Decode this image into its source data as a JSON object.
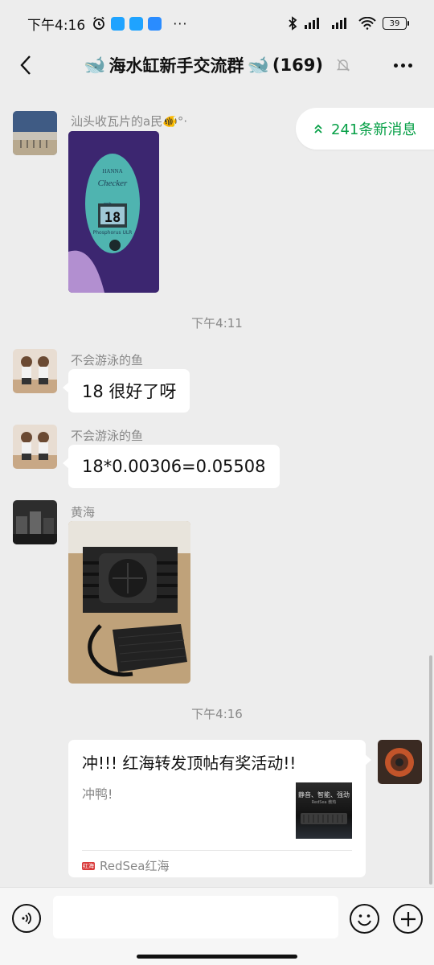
{
  "status_bar": {
    "time": "下午4:16",
    "more": "···",
    "battery": "39"
  },
  "header": {
    "whale_left": "🐋",
    "title": "海水缸新手交流群",
    "whale_right": "🐋",
    "member_count": "(169)"
  },
  "new_messages": {
    "label": "241条新消息"
  },
  "messages": [
    {
      "sender": "汕头收瓦片的a民🐠°·",
      "type": "image",
      "image_text": {
        "brand": "HANNA",
        "model": "Checker",
        "reading": "18",
        "unit": "ppb",
        "product": "Phosphorus ULR"
      }
    },
    {
      "type": "time",
      "text": "下午4:11"
    },
    {
      "sender": "不会游泳的鱼",
      "type": "text",
      "text": "18 很好了呀"
    },
    {
      "sender": "不会游泳的鱼",
      "type": "text",
      "text": "18*0.00306=0.05508"
    },
    {
      "sender": "黄海",
      "type": "image"
    },
    {
      "type": "time",
      "text": "下午4:16"
    },
    {
      "type": "link_card",
      "title": "冲!!! 红海转发顶帖有奖活动!!",
      "description": "冲鸭!",
      "thumb_text": "静音、智能、强劲",
      "thumb_subtext": "RedSea 散热",
      "source": "RedSea红海",
      "source_logo": "红海"
    }
  ],
  "input_bar": {
    "placeholder": ""
  },
  "colors": {
    "accent_green": "#07a047",
    "background": "#ededed",
    "bubble": "#ffffff"
  }
}
